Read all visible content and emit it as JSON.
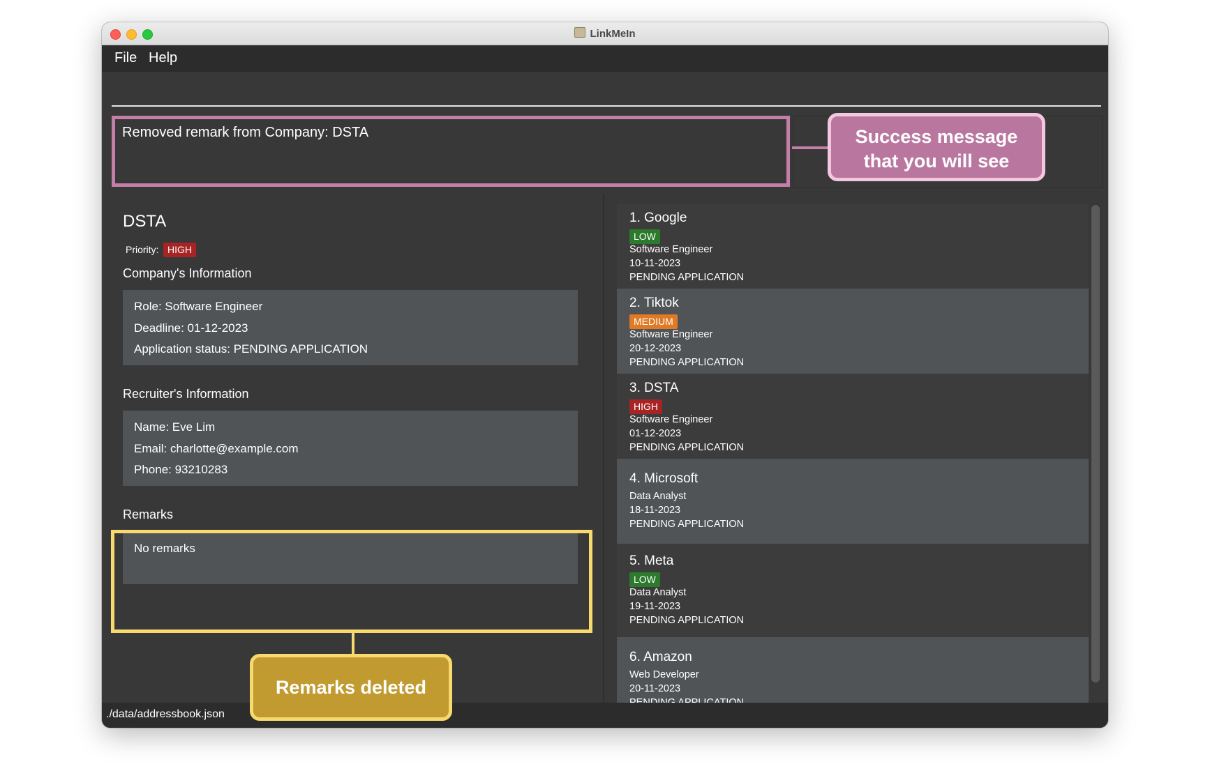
{
  "window": {
    "title": "LinkMeIn"
  },
  "menu": {
    "file": "File",
    "help": "Help"
  },
  "command": {
    "value": "",
    "placeholder": ""
  },
  "result": {
    "message": "Removed remark from Company: DSTA"
  },
  "annotations": {
    "success": [
      "Success message",
      "that you will see"
    ],
    "remarks": "Remarks deleted"
  },
  "detail": {
    "name": "DSTA",
    "priority_label": "Priority:",
    "priority": "HIGH",
    "company_section": "Company's Information",
    "role": "Role: Software Engineer",
    "deadline": "Deadline: 01-12-2023",
    "status": "Application status: PENDING APPLICATION",
    "recruiter_section": "Recruiter's Information",
    "recruiter_name": "Name: Eve Lim",
    "recruiter_email": "Email: charlotte@example.com",
    "recruiter_phone": "Phone: 93210283",
    "remarks_section": "Remarks",
    "remarks": "No remarks"
  },
  "companies": [
    {
      "title": "1.  Google",
      "priority": "LOW",
      "role": "Software Engineer",
      "deadline": "10-11-2023",
      "status": "PENDING APPLICATION"
    },
    {
      "title": "2.  Tiktok",
      "priority": "MEDIUM",
      "role": "Software Engineer",
      "deadline": "20-12-2023",
      "status": "PENDING APPLICATION"
    },
    {
      "title": "3.  DSTA",
      "priority": "HIGH",
      "role": "Software Engineer",
      "deadline": "01-12-2023",
      "status": "PENDING APPLICATION"
    },
    {
      "title": "4.  Microsoft",
      "priority": "",
      "role": "Data Analyst",
      "deadline": "18-11-2023",
      "status": "PENDING APPLICATION"
    },
    {
      "title": "5.  Meta",
      "priority": "LOW",
      "role": "Data Analyst",
      "deadline": "19-11-2023",
      "status": "PENDING APPLICATION"
    },
    {
      "title": "6.  Amazon",
      "priority": "",
      "role": "Web Developer",
      "deadline": "20-11-2023",
      "status": "PENDING APPLICATION"
    }
  ],
  "statusbar": {
    "path": "./data/addressbook.json"
  },
  "colors": {
    "high": "#a82424",
    "medium": "#e07a24",
    "low": "#2c7a2c",
    "success_frame": "#c47fa8",
    "remarks_frame": "#f8d96e"
  }
}
